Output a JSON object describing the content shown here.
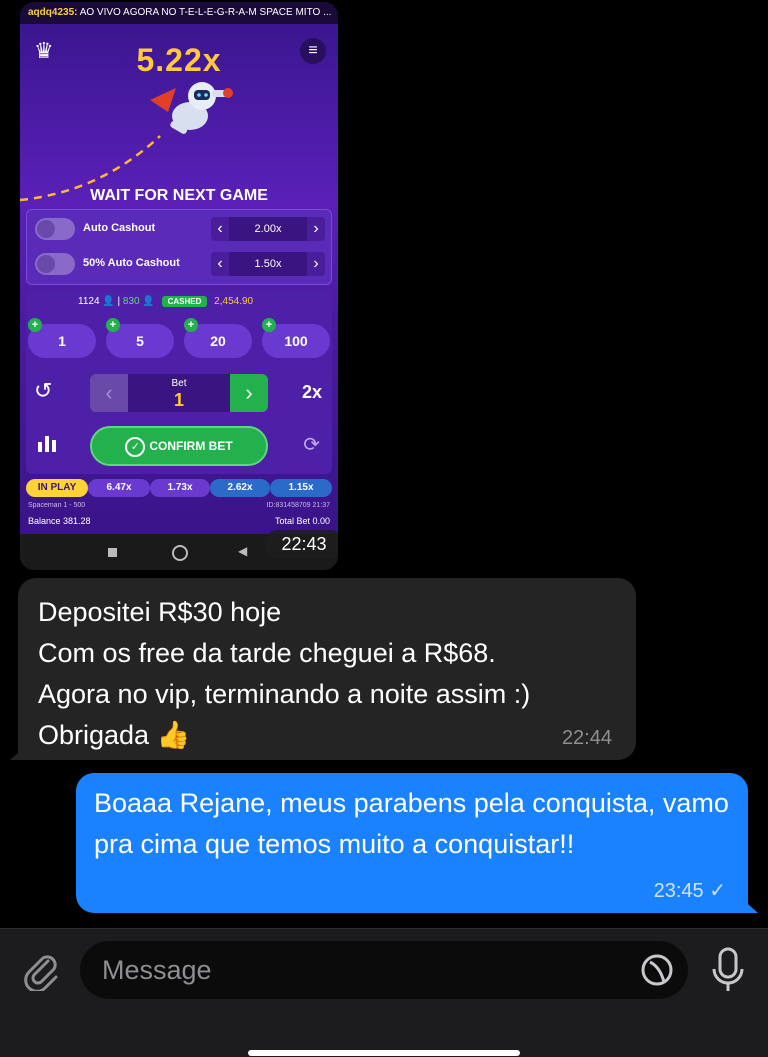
{
  "game": {
    "ticker_user": "aqdq4235:",
    "ticker_text": "AO VIVO AGORA NO T-E-L-E-G-R-A-M SPACE MITO ...",
    "multiplier": "5.22x",
    "status": "WAIT FOR NEXT GAME",
    "auto": [
      {
        "label": "Auto Cashout",
        "value": "2.00x"
      },
      {
        "label": "50% Auto Cashout",
        "value": "1.50x"
      }
    ],
    "stats": {
      "players": "1124",
      "cashed_count": "830",
      "cashed_label": "CASHED",
      "cashed_amount": "2,454.90"
    },
    "chips": [
      "1",
      "5",
      "20",
      "100"
    ],
    "bet_label": "Bet",
    "bet_value": "1",
    "double_label": "2x",
    "confirm_label": "CONFIRM BET",
    "history": [
      "IN PLAY",
      "6.47x",
      "1.73x",
      "2.62x",
      "1.15x"
    ],
    "game_name": "Spaceman 1 - 500",
    "round_id": "ID:831458709 21:37",
    "balance": "Balance 381.28",
    "total_bet": "Total Bet 0.00"
  },
  "image_time": "22:43",
  "received": {
    "lines": [
      "Depositei R$30 hoje",
      "Com os free da tarde cheguei a R$68.",
      "Agora no vip, terminando a noite assim :)",
      "Obrigada"
    ],
    "emoji": "👍",
    "time": "22:44"
  },
  "sent": {
    "text": "Boaaa Rejane, meus parabens pela conquista, vamo pra cima que temos muito a conquistar!!",
    "time": "23:45",
    "check": "✓"
  },
  "input": {
    "placeholder": "Message"
  },
  "colors": {
    "sent_bubble": "#1a82ff",
    "received_bubble": "#242424",
    "game_bg": "#4a1aa0",
    "accent_gold": "#ffc93a",
    "confirm_green": "#22b14c"
  },
  "icons": [
    "crown-icon",
    "menu-icon",
    "undo-icon",
    "stats-icon",
    "refresh-icon",
    "paperclip-icon",
    "sticker-icon",
    "microphone-icon"
  ]
}
